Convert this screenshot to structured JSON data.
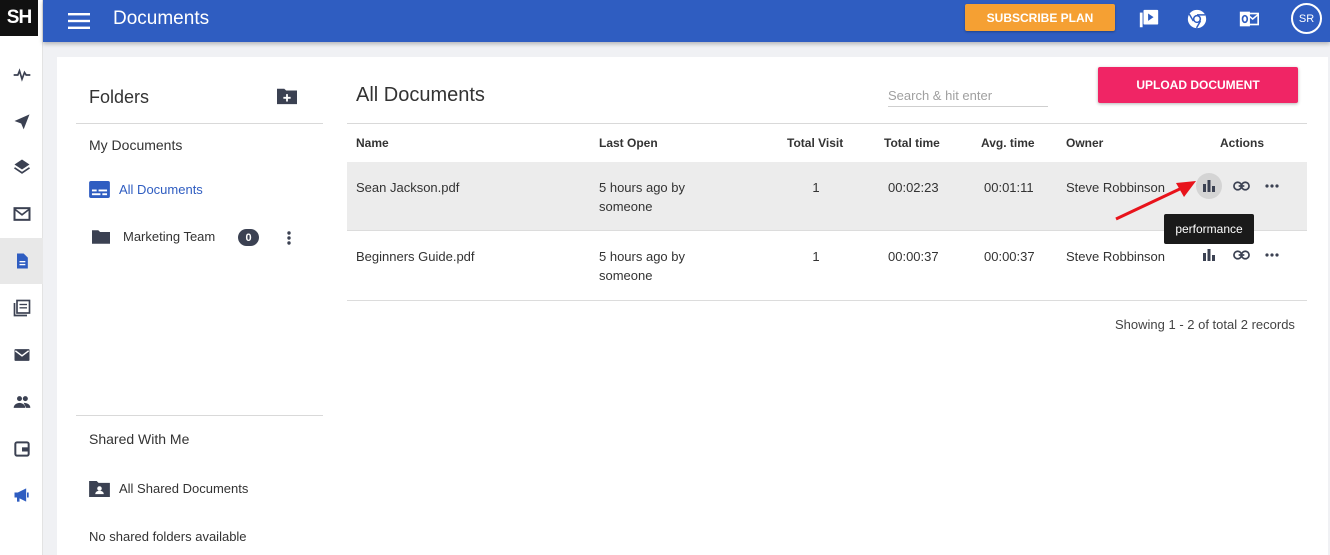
{
  "app": {
    "logo_text": "SH",
    "page_title": "Documents"
  },
  "topbar": {
    "subscribe_label": "SUBSCRIBE PLAN",
    "icons": [
      "video-icon",
      "chrome-icon",
      "outlook-icon"
    ],
    "avatar_initials": "SR"
  },
  "rail": {
    "items": [
      "activity-icon",
      "send-icon",
      "layers-icon",
      "inbox-icon",
      "documents-icon",
      "templates-icon",
      "mail-icon",
      "contacts-icon",
      "wallet-icon",
      "megaphone-icon"
    ],
    "active": "documents-icon"
  },
  "folders": {
    "title": "Folders",
    "my_documents": "My Documents",
    "all_documents": "All Documents",
    "items": [
      {
        "label": "Marketing Team",
        "count": "0"
      }
    ],
    "shared_title": "Shared With Me",
    "all_shared": "All Shared Documents",
    "no_shared": "No shared folders available"
  },
  "documents": {
    "title": "All Documents",
    "search_placeholder": "Search & hit enter",
    "upload_label": "UPLOAD DOCUMENT",
    "columns": [
      "Name",
      "Last Open",
      "Total Visit",
      "Total time",
      "Avg. time",
      "Owner",
      "Actions"
    ],
    "rows": [
      {
        "name": "Sean Jackson.pdf",
        "last_open": "5 hours ago by",
        "last_open_by": "someone",
        "total_visit": "1",
        "total_time": "00:02:23",
        "avg_time": "00:01:11",
        "owner": "Steve Robbinson"
      },
      {
        "name": "Beginners Guide.pdf",
        "last_open": "5 hours ago by",
        "last_open_by": "someone",
        "total_visit": "1",
        "total_time": "00:00:37",
        "avg_time": "00:00:37",
        "owner": "Steve Robbinson"
      }
    ],
    "tooltip": "performance",
    "showing": "Showing 1 - 2 of total 2 records"
  },
  "colors": {
    "brand": "#2f5dc1",
    "subscribe": "#f5a033",
    "upload": "#f02565",
    "rail_icon": "#3b4152",
    "arrow": "#e8131b"
  }
}
